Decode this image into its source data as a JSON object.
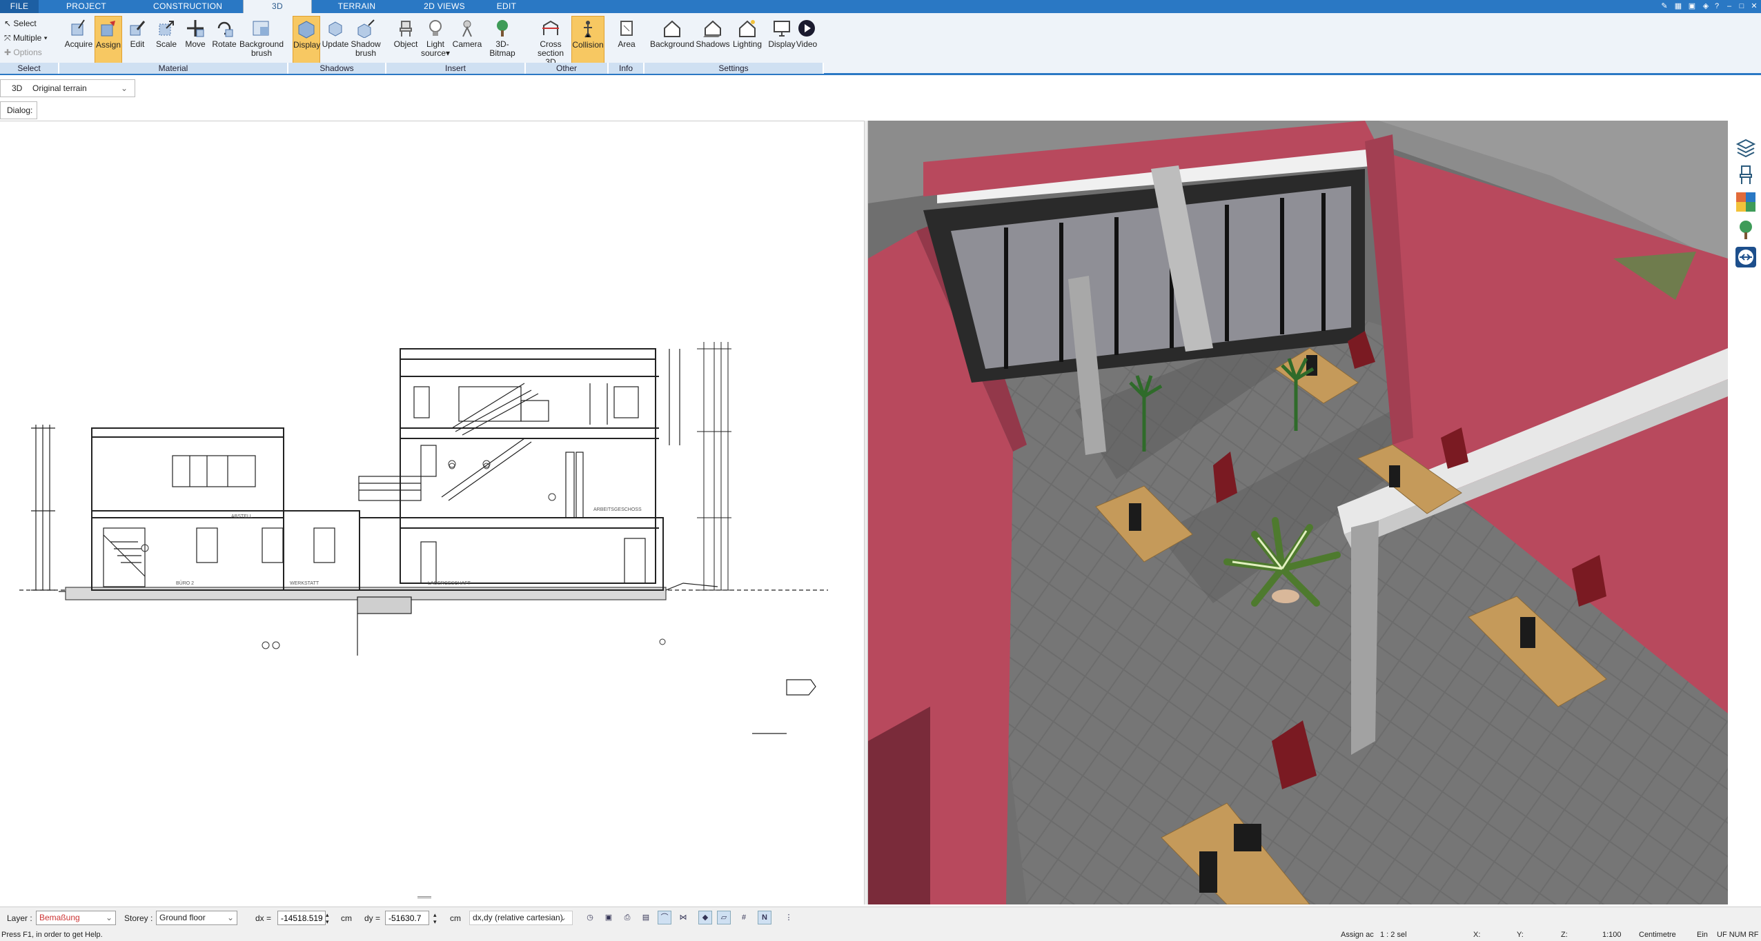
{
  "tabs": [
    {
      "label": "FILE"
    },
    {
      "label": "PROJECT"
    },
    {
      "label": "CONSTRUCTION"
    },
    {
      "label": "3D"
    },
    {
      "label": "TERRAIN"
    },
    {
      "label": "2D VIEWS"
    },
    {
      "label": "EDIT"
    }
  ],
  "ribbon": {
    "select_group": {
      "select": "Select",
      "multiple": "Multiple",
      "options": "Options"
    },
    "buttons": [
      {
        "label": "Acquire"
      },
      {
        "label": "Assign"
      },
      {
        "label": "Edit"
      },
      {
        "label": "Scale"
      },
      {
        "label": "Move"
      },
      {
        "label": "Rotate"
      },
      {
        "label": "Background\nbrush"
      },
      {
        "label": "Display"
      },
      {
        "label": "Update"
      },
      {
        "label": "Shadow\nbrush"
      },
      {
        "label": "Object"
      },
      {
        "label": "Light\nsource"
      },
      {
        "label": "Camera"
      },
      {
        "label": "3D-Bitmap"
      },
      {
        "label": "Cross\nsection 3D"
      },
      {
        "label": "Collision"
      },
      {
        "label": "Area"
      },
      {
        "label": "Background"
      },
      {
        "label": "Shadows"
      },
      {
        "label": "Lighting"
      },
      {
        "label": "Display"
      },
      {
        "label": "Video"
      }
    ],
    "groups": [
      {
        "label": "Select"
      },
      {
        "label": "Material"
      },
      {
        "label": "Shadows"
      },
      {
        "label": "Insert"
      },
      {
        "label": "Other"
      },
      {
        "label": "Info"
      },
      {
        "label": "Settings"
      }
    ]
  },
  "viewbar": {
    "mode": "3D",
    "terrain": "Original terrain"
  },
  "dialog": {
    "label": "Dialog:"
  },
  "drawing": {
    "labels": [
      "WERKSTATT",
      "BÜRO 2",
      "LAGERGESCHAFT",
      "ABSTELL",
      "ARBEITSGESCHOSS"
    ]
  },
  "statusbar": {
    "layer_label": "Layer :",
    "layer_value": "Bemaßung",
    "storey_label": "Storey :",
    "storey_value": "Ground floor",
    "dx_label": "dx =",
    "dx_value": "-14518.519",
    "dx_unit": "cm",
    "dy_label": "dy =",
    "dy_value": "-51630.7",
    "dy_unit": "cm",
    "coord_mode": "dx,dy (relative cartesian)",
    "assign": "Assign ac",
    "selection": "1 : 2 sel",
    "x": "X:",
    "y": "Y:",
    "z": "Z:",
    "scale": "1:100",
    "unit": "Centimetre",
    "ein": "Ein",
    "flags": "UF  NUM  RF"
  },
  "help": {
    "text": "Press F1, in order to get Help."
  },
  "colors": {
    "accent": "#2a78c4",
    "active_button": "#f7c862",
    "wall": "#b8495d"
  }
}
